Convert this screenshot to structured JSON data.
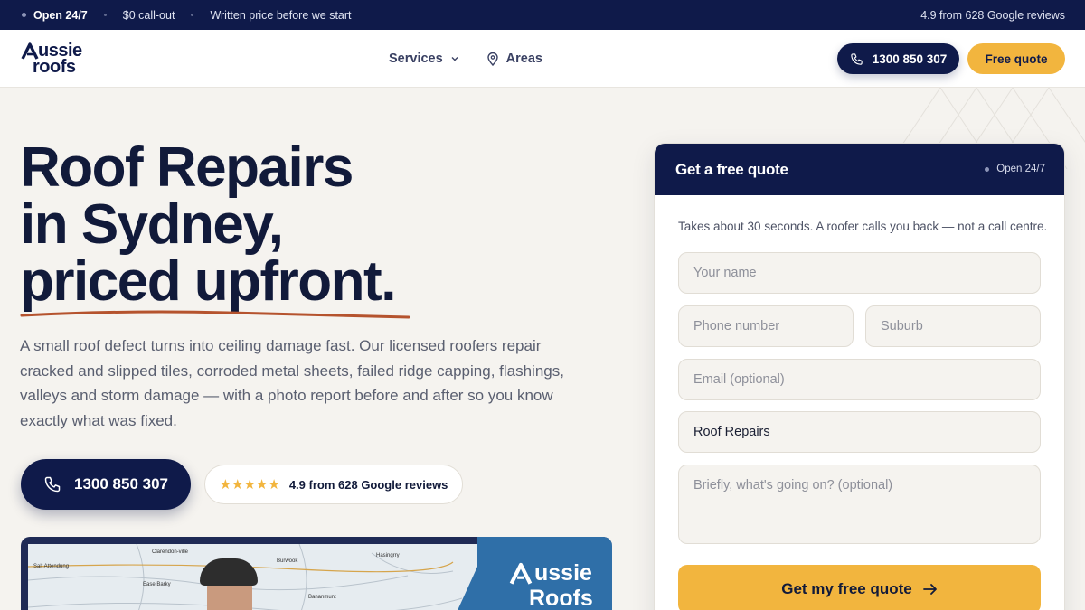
{
  "topbar": {
    "open": "Open 24/7",
    "callout": "$0 call-out",
    "written_price": "Written price before we start",
    "rating": "4.9 from 628 Google reviews"
  },
  "nav": {
    "logo_line1": "ussie",
    "logo_line2": "roofs",
    "services": "Services",
    "areas": "Areas",
    "phone": "1300 850 307",
    "quote": "Free quote"
  },
  "hero": {
    "title_lines": [
      "Roof Repairs",
      "in Sydney,",
      "priced upfront."
    ],
    "description": "A small roof defect turns into ceiling damage fast. Our licensed roofers repair cracked and slipped tiles, corroded metal sheets, failed ridge capping, flashings, valleys and storm damage — with a photo report before and after so you know exactly what was fixed.",
    "phone": "1300 850 307",
    "stars": "★★★★★",
    "reviews": "4.9 from 628 Google reviews"
  },
  "mapcard": {
    "labels": [
      "Clarendon-ville",
      "Salt Attendung",
      "Ease Barky",
      "Burwook",
      "Hasingrry",
      "Bananmunt"
    ],
    "brand_line1": "ussie",
    "brand_line2": "Roofs"
  },
  "form": {
    "title": "Get a free quote",
    "status": "Open 24/7",
    "subtitle": "Takes about 30 seconds. A roofer calls you back — not a call centre.",
    "name_placeholder": "Your name",
    "phone_placeholder": "Phone number",
    "suburb_placeholder": "Suburb",
    "email_placeholder": "Email (optional)",
    "service_value": "Roof Repairs",
    "message_placeholder": "Briefly, what's going on? (optional)",
    "submit": "Get my free quote"
  },
  "colors": {
    "navy": "#0f1a4a",
    "gold": "#f2b53e",
    "background": "#f5f3ef",
    "underline": "#b5532e"
  }
}
